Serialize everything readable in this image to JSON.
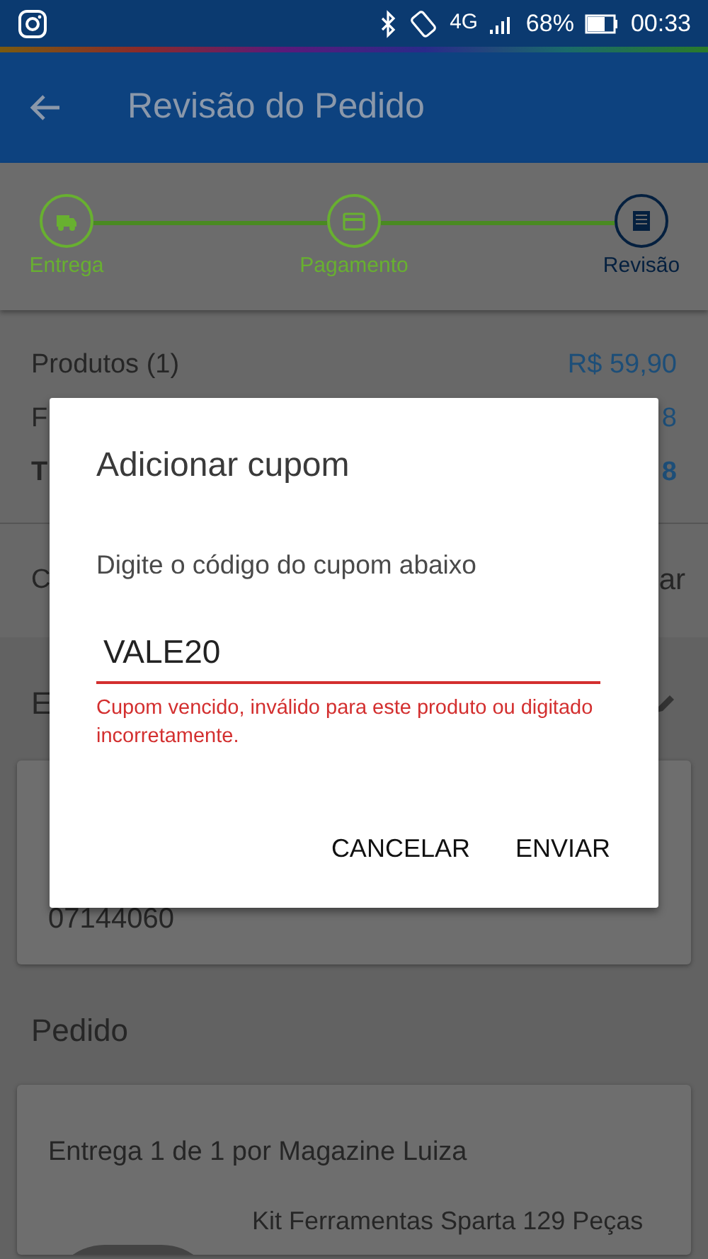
{
  "status_bar": {
    "network": "4G",
    "battery": "68%",
    "time": "00:33"
  },
  "app_bar": {
    "title": "Revisão do Pedido"
  },
  "steps": [
    {
      "label": "Entrega",
      "kind": "truck",
      "selected": false
    },
    {
      "label": "Pagamento",
      "kind": "card",
      "selected": false
    },
    {
      "label": "Revisão",
      "kind": "receipt",
      "selected": true
    }
  ],
  "summary": [
    {
      "label": "Produtos (1)",
      "value": "R$ 59,90",
      "bold": false
    },
    {
      "label": "F",
      "value": "8",
      "bold": false
    },
    {
      "label": "T",
      "value": "8",
      "bold": true
    }
  ],
  "coupon_row": {
    "label": "C",
    "action": "ar"
  },
  "address_section": {
    "heading": "E",
    "lines": [
      "07144060"
    ]
  },
  "order_section": {
    "heading": "Pedido",
    "delivery": "Entrega 1 de 1 por Magazine Luiza",
    "product": "Kit Ferramentas Sparta 129 Peças"
  },
  "dialog": {
    "title": "Adicionar cupom",
    "message": "Digite o código do cupom abaixo",
    "value": "VALE20",
    "invalid": true,
    "error": "Cupom vencido, inválido para este produto ou digitado incorretamente.",
    "buttons": [
      "CANCELAR",
      "ENVIAR"
    ]
  }
}
